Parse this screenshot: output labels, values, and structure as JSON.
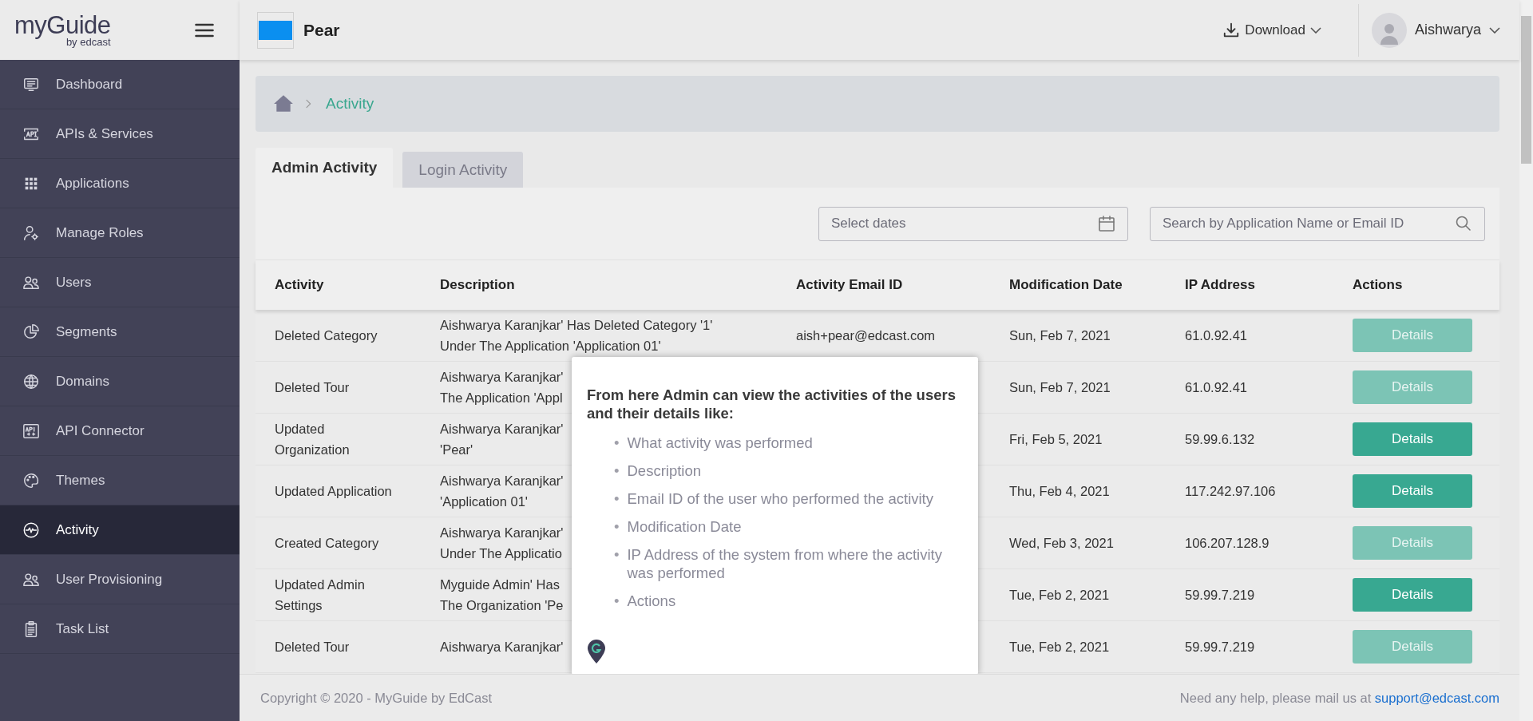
{
  "logo": {
    "name": "myGuide",
    "byline": "by edcast"
  },
  "sidebar": {
    "items": [
      {
        "label": "Dashboard",
        "selected": false
      },
      {
        "label": "APIs & Services",
        "selected": false
      },
      {
        "label": "Applications",
        "selected": false
      },
      {
        "label": "Manage Roles",
        "selected": false
      },
      {
        "label": "Users",
        "selected": false
      },
      {
        "label": "Segments",
        "selected": false
      },
      {
        "label": "Domains",
        "selected": false
      },
      {
        "label": "API Connector",
        "selected": false
      },
      {
        "label": "Themes",
        "selected": false
      },
      {
        "label": "Activity",
        "selected": true
      },
      {
        "label": "User Provisioning",
        "selected": false
      },
      {
        "label": "Task List",
        "selected": false
      }
    ]
  },
  "header": {
    "app_name": "Pear",
    "download": "Download",
    "user": "Aishwarya"
  },
  "breadcrumb": {
    "current": "Activity"
  },
  "tabs": [
    {
      "label": "Admin Activity",
      "selected": true
    },
    {
      "label": "Login Activity",
      "selected": false
    }
  ],
  "filters": {
    "date_placeholder": "Select dates",
    "search_placeholder": "Search by Application Name or Email ID"
  },
  "table": {
    "columns": [
      "Activity",
      "Description",
      "Activity Email ID",
      "Modification Date",
      "IP Address",
      "Actions"
    ],
    "rows": [
      {
        "activity": [
          "Deleted Category"
        ],
        "description": [
          "Aishwarya Karanjkar' Has Deleted Category '1'",
          "Under The Application 'Application 01'"
        ],
        "email": "aish+pear@edcast.com",
        "date": "Sun, Feb 7, 2021",
        "ip": "61.0.92.41",
        "action": "Details",
        "disabled": true
      },
      {
        "activity": [
          "Deleted Tour"
        ],
        "description": [
          "Aishwarya Karanjkar'",
          "The Application 'Appl"
        ],
        "date": "Sun, Feb 7, 2021",
        "ip": "61.0.92.41",
        "action": "Details",
        "disabled": true
      },
      {
        "activity": [
          "Updated",
          "Organization"
        ],
        "description": [
          "Aishwarya Karanjkar'",
          "'Pear'"
        ],
        "date": "Fri, Feb 5, 2021",
        "ip": "59.99.6.132",
        "action": "Details",
        "disabled": false
      },
      {
        "activity": [
          "Updated Application"
        ],
        "description": [
          "Aishwarya Karanjkar'",
          "'Application 01'"
        ],
        "date": "Thu, Feb 4, 2021",
        "ip": "117.242.97.106",
        "action": "Details",
        "disabled": false
      },
      {
        "activity": [
          "Created Category"
        ],
        "description": [
          "Aishwarya Karanjkar'",
          "Under The Applicatio"
        ],
        "date": "Wed, Feb 3, 2021",
        "ip": "106.207.128.9",
        "action": "Details",
        "disabled": true
      },
      {
        "activity": [
          "Updated Admin",
          "Settings"
        ],
        "description": [
          "Myguide Admin' Has",
          "The Organization 'Pe"
        ],
        "date": "Tue, Feb 2, 2021",
        "ip": "59.99.7.219",
        "action": "Details",
        "disabled": false
      },
      {
        "activity": [
          "Deleted Tour"
        ],
        "description": [
          "Aishwarya Karanjkar'"
        ],
        "date": "Tue, Feb 2, 2021",
        "ip": "59.99.7.219",
        "action": "Details",
        "disabled": true
      }
    ]
  },
  "tooltip": {
    "bullet": "•",
    "heading": "From here Admin can view the activities of the users and their details like:",
    "items": [
      "What activity was performed",
      "Description",
      "Email ID of the user who performed the activity",
      "Modification Date",
      "IP Address of the system from where the activity was performed",
      "Actions"
    ]
  },
  "footer": {
    "copyright": "Copyright © 2020 - MyGuide by EdCast",
    "help": "Need any help, please mail us at",
    "email": "support@edcast.com"
  }
}
